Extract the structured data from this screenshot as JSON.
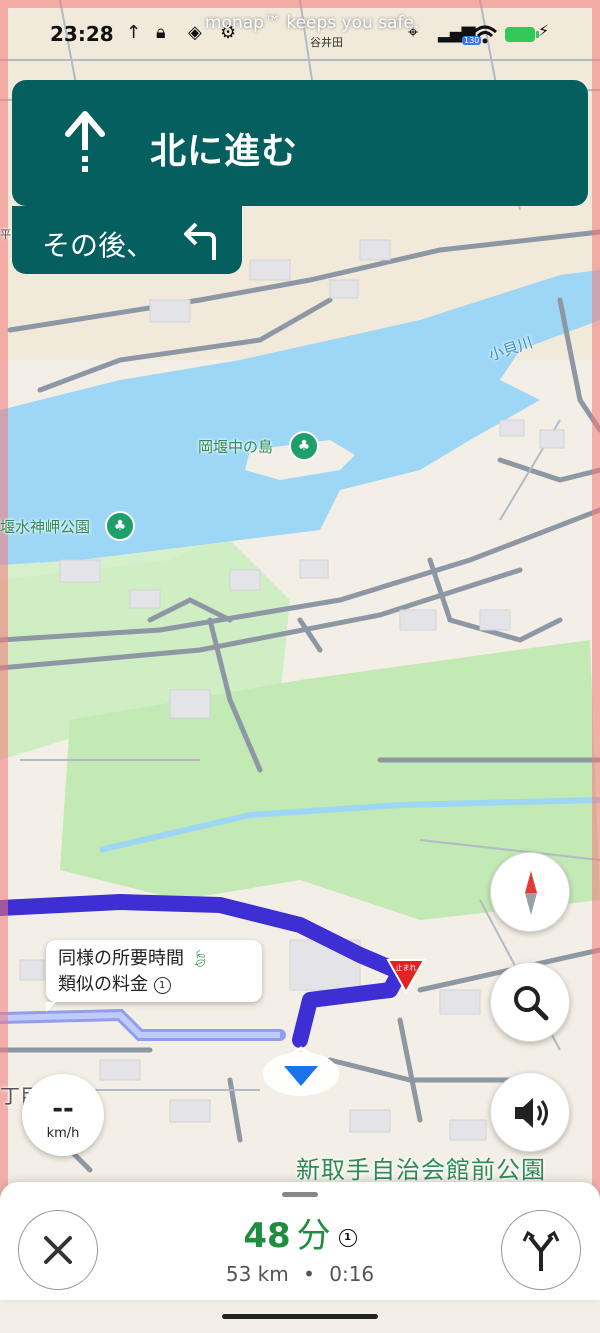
{
  "status_bar": {
    "time": "23:28",
    "banner": "monap™ keeps you safe.",
    "sub_label": "谷井田",
    "signal_badge": "130"
  },
  "navigation": {
    "instruction": "北に進む",
    "then_label": "その後、",
    "main_arrow_icon": "arrow-up-icon",
    "then_turn_icon": "turn-left-icon"
  },
  "map": {
    "labels": {
      "river": "小貝川",
      "island": "岡堰中の島",
      "park_left": "堰水神岬公園",
      "place_bottom": "新取手自治会館前公園",
      "edge_left": "丁目",
      "edge_top_left": "平"
    },
    "route_callout": {
      "line1": "同様の所要時間",
      "line2": "類似の料金",
      "info": "1"
    },
    "stop_sign_text": "止まれ"
  },
  "speed": {
    "value": "--",
    "unit": "km/h"
  },
  "trip": {
    "minutes": "48",
    "minutes_unit": "分",
    "info": "1",
    "distance": "53 km",
    "separator": "•",
    "arrival_time": "0:16"
  },
  "colors": {
    "nav_bg": "#045f5e",
    "route": "#3d2fd3",
    "eta_green": "#1e8e3e",
    "water": "#9dd7f5",
    "park": "#c6eab8"
  }
}
